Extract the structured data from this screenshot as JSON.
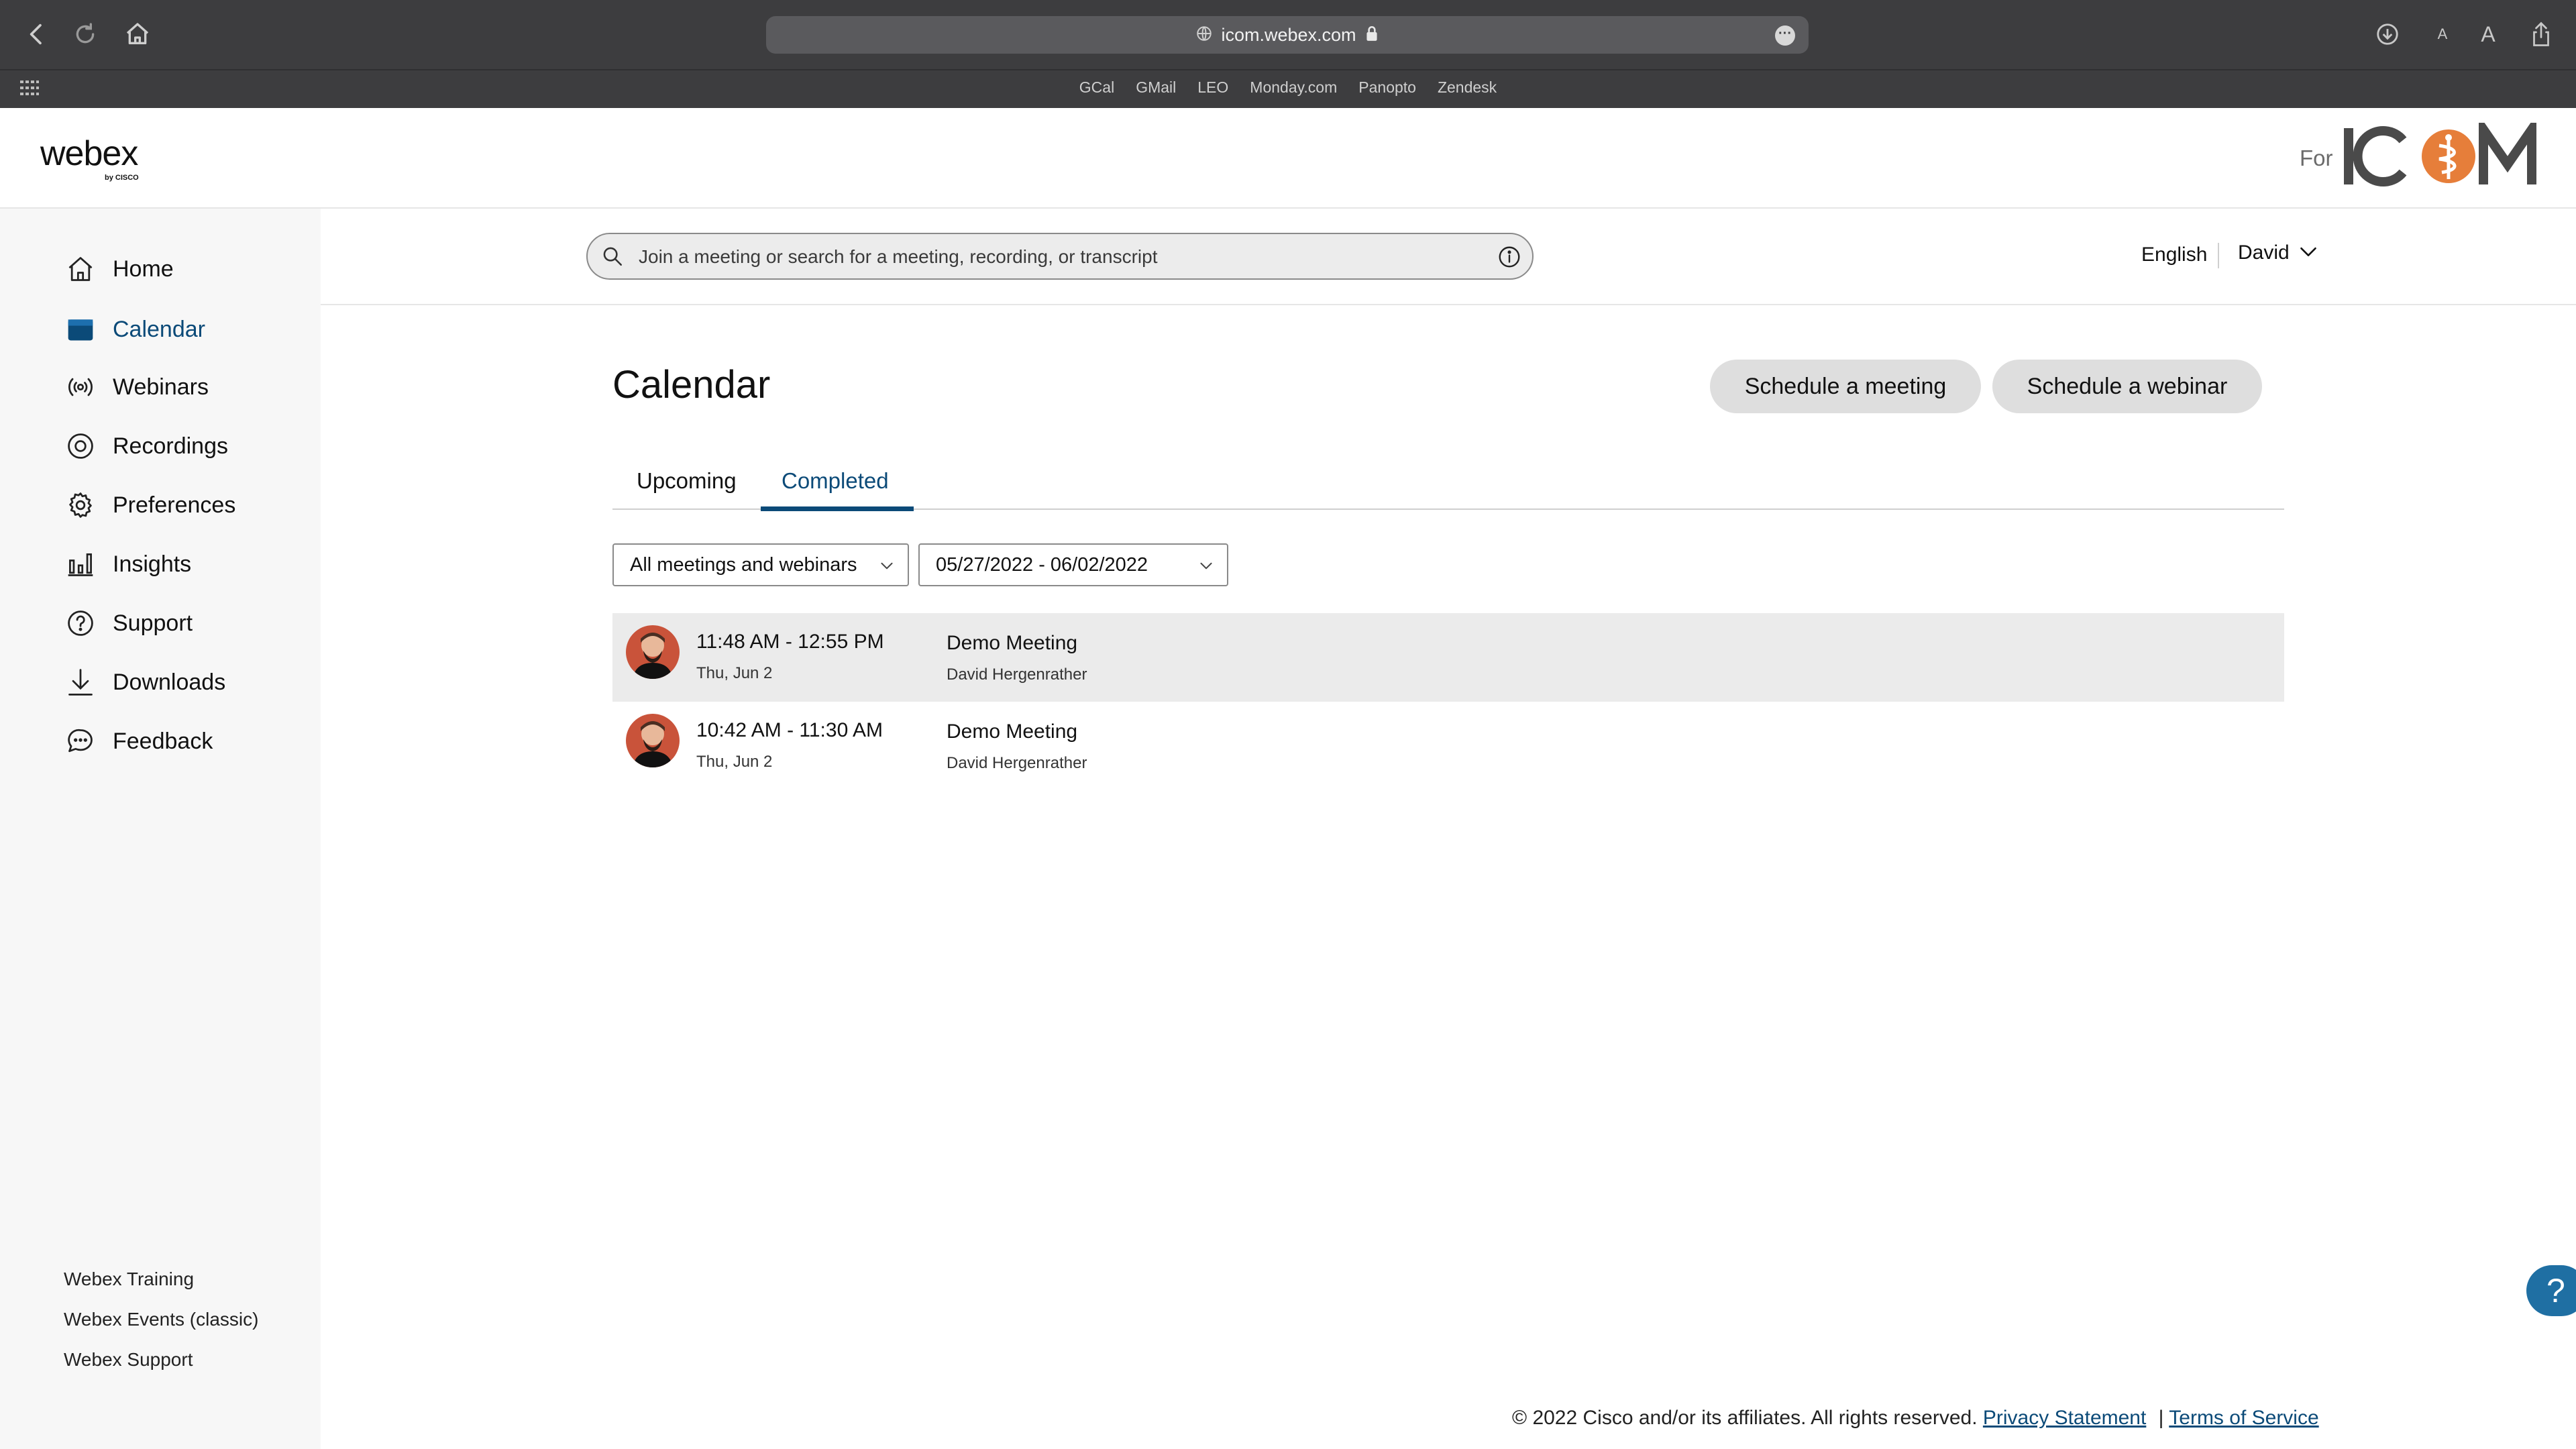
{
  "browser": {
    "url": "icom.webex.com",
    "bookmarks": [
      "GCal",
      "GMail",
      "LEO",
      "Monday.com",
      "Panopto",
      "Zendesk"
    ],
    "font_small_label": "A",
    "font_large_label": "A"
  },
  "header": {
    "logo_text": "webex",
    "logo_sub": "by CISCO",
    "for_label": "For",
    "brand_logo": "ICOM",
    "brand_color": "#e67e3a"
  },
  "search": {
    "placeholder": "Join a meeting or search for a meeting, recording, or transcript"
  },
  "user_bar": {
    "language": "English",
    "user_name": "David"
  },
  "sidebar": {
    "items": [
      {
        "label": "Home",
        "icon": "home-icon"
      },
      {
        "label": "Calendar",
        "icon": "calendar-icon",
        "active": true
      },
      {
        "label": "Webinars",
        "icon": "broadcast-icon"
      },
      {
        "label": "Recordings",
        "icon": "recording-icon"
      },
      {
        "label": "Preferences",
        "icon": "gear-icon"
      },
      {
        "label": "Insights",
        "icon": "bar-chart-icon"
      },
      {
        "label": "Support",
        "icon": "help-circle-icon"
      },
      {
        "label": "Downloads",
        "icon": "download-icon"
      },
      {
        "label": "Feedback",
        "icon": "chat-bubble-icon"
      }
    ],
    "footer_links": [
      "Webex Training",
      "Webex Events (classic)",
      "Webex Support"
    ]
  },
  "main": {
    "title": "Calendar",
    "schedule_meeting": "Schedule a meeting",
    "schedule_webinar": "Schedule a webinar",
    "tabs": [
      {
        "label": "Upcoming",
        "active": false
      },
      {
        "label": "Completed",
        "active": true
      }
    ],
    "filter_type": "All meetings and webinars",
    "filter_dates": "05/27/2022 - 06/02/2022",
    "meetings": [
      {
        "time": "11:48 AM - 12:55 PM",
        "date": "Thu, Jun 2",
        "title": "Demo Meeting",
        "host": "David Hergenrather"
      },
      {
        "time": "10:42 AM - 11:30 AM",
        "date": "Thu, Jun 2",
        "title": "Demo Meeting",
        "host": "David Hergenrather"
      }
    ]
  },
  "help_button": "?",
  "footer": {
    "copyright": "© 2022 Cisco and/or its affiliates. All rights reserved.",
    "privacy": "Privacy Statement",
    "separator": "|",
    "terms": "Terms of Service"
  },
  "colors": {
    "accent": "#0b4a78",
    "sidebar_bg": "#f7f7f7",
    "chrome_bg": "#3d3d3f",
    "highlight_row": "#ebebeb"
  }
}
